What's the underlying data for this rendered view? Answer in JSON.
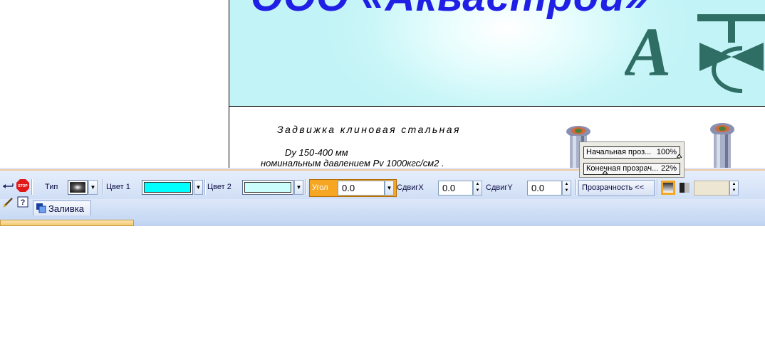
{
  "document": {
    "company_title": "ООО «Аквастрой»",
    "product_title": "Задвижка клиновая стальная",
    "spec_size": "Dy 150-400 мм",
    "spec_pressure": "номинальным давлением Pv 1000кгс/см2 ."
  },
  "transparency_popup": {
    "start_label": "Начальная проз...",
    "start_value": "100%",
    "end_label": "Конечная прозрач...",
    "end_value": "22%"
  },
  "fill_toolbar": {
    "type_label": "Тип",
    "type_mnemonic": "Т",
    "color1_label": "Цвет 1",
    "color1_value": "#00ffff",
    "color2_label": "Цвет 2",
    "color2_value": "#ccfdfd",
    "angle_label": "Угол",
    "angle_value": "0.0",
    "shiftx_label": "СдвигX",
    "shiftx_value": "0.0",
    "shifty_label": "СдвигY",
    "shifty_value": "0.0",
    "transparency_button": "Прозрачность  <<"
  },
  "tabs": {
    "fill_tab": "Заливка"
  },
  "left_tools": {
    "icons": [
      "arrow-return-icon",
      "stop-icon",
      "brush-icon",
      "help-icon"
    ]
  },
  "colors": {
    "title_blue": "#1f1fe6",
    "logo_teal": "#2e6e64",
    "angle_highlight": "#f5a623"
  }
}
